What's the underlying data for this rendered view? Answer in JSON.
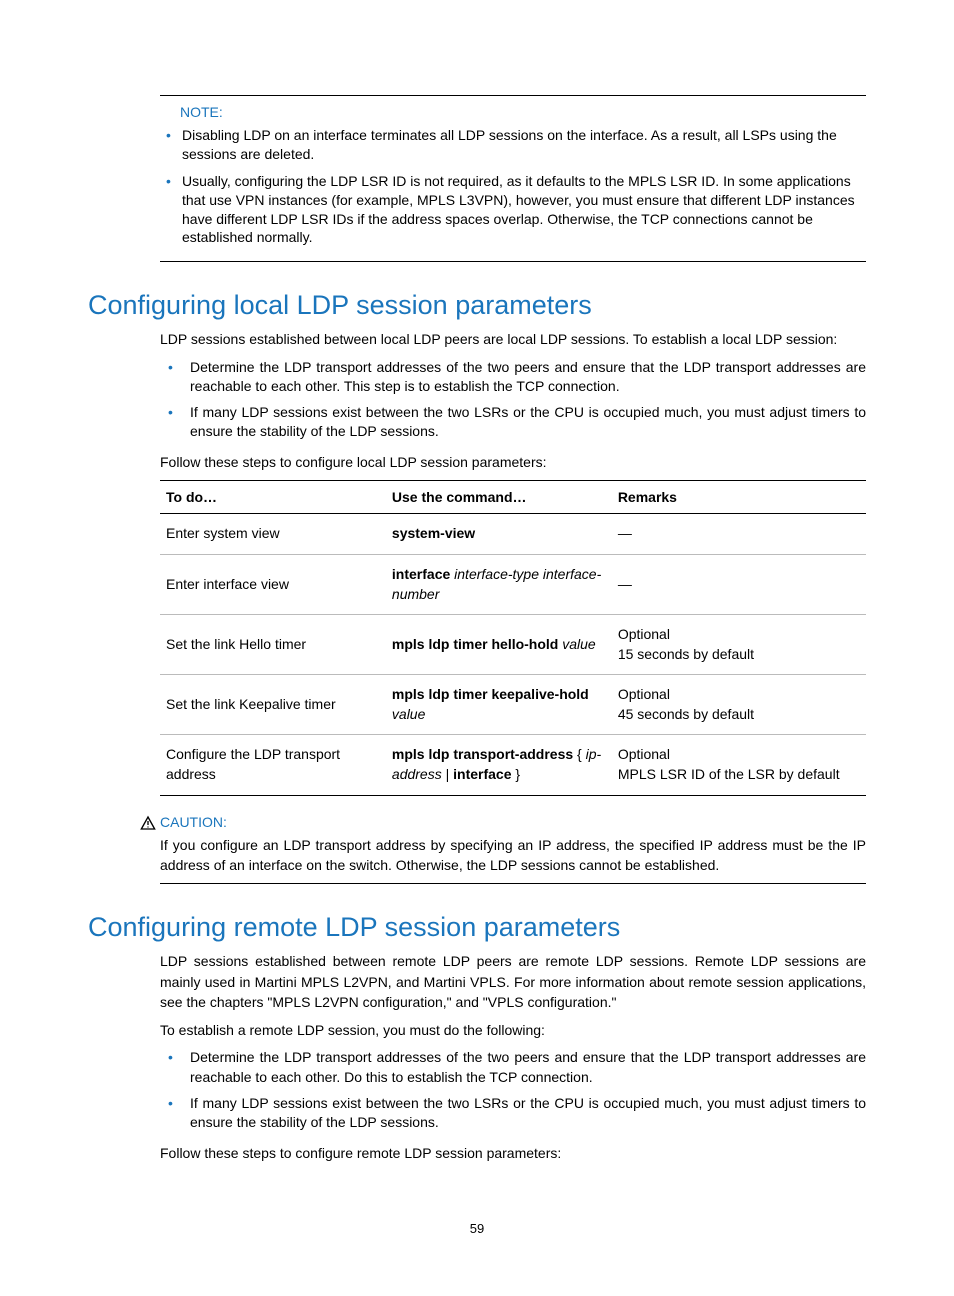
{
  "note": {
    "label": "NOTE:",
    "items": [
      "Disabling LDP on an interface terminates all LDP sessions on the interface. As a result, all LSPs using the sessions are deleted.",
      "Usually, configuring the LDP LSR ID is not required, as it defaults to the MPLS LSR ID. In some applications that use VPN instances (for example, MPLS L3VPN), however, you must ensure that different LDP instances have different LDP LSR IDs if the address spaces overlap. Otherwise, the TCP connections cannot be established normally."
    ]
  },
  "section1": {
    "heading": "Configuring local LDP session parameters",
    "intro": "LDP sessions established between local LDP peers are local LDP sessions. To establish a local LDP session:",
    "bullets": [
      "Determine the LDP transport addresses of the two peers and ensure that the LDP transport addresses are reachable to each other. This step is to establish the TCP connection.",
      "If many LDP sessions exist between the two LSRs or the CPU is occupied much, you must adjust timers to ensure the stability of the LDP sessions."
    ],
    "lead": "Follow these steps to configure local LDP session parameters:"
  },
  "table": {
    "headers": [
      "To do…",
      "Use the command…",
      "Remarks"
    ],
    "rows": [
      {
        "todo": "Enter system view",
        "cmd_html": "<b>system-view</b>",
        "remarks_html": "—"
      },
      {
        "todo": "Enter interface view",
        "cmd_html": "<b>interface</b> <i>interface-type interface-number</i>",
        "remarks_html": "—"
      },
      {
        "todo": "Set the link Hello timer",
        "cmd_html": "<b>mpls ldp timer hello-hold</b> <i>value</i>",
        "remarks_html": "Optional<br>15 seconds by default"
      },
      {
        "todo": "Set the link Keepalive timer",
        "cmd_html": "<b>mpls ldp timer keepalive-hold</b> <i>value</i>",
        "remarks_html": "Optional<br>45 seconds by default"
      },
      {
        "todo": "Configure the LDP transport address",
        "cmd_html": "<b>mpls ldp transport-address</b> { <i>ip-address</i> | <b>interface</b> }",
        "remarks_html": "Optional<br>MPLS LSR ID of the LSR by default"
      }
    ]
  },
  "caution": {
    "label": "CAUTION:",
    "text": "If you configure an LDP transport address by specifying an IP address, the specified IP address must be the IP address of an interface on the switch. Otherwise, the LDP sessions cannot be established."
  },
  "section2": {
    "heading": "Configuring remote LDP session parameters",
    "intro": "LDP sessions established between remote LDP peers are remote LDP sessions. Remote LDP sessions are mainly used in Martini MPLS L2VPN, and Martini VPLS. For more information about remote session applications, see the chapters \"MPLS L2VPN configuration,\" and \"VPLS configuration.\"",
    "lead": "To establish a remote LDP session, you must do the following:",
    "bullets": [
      "Determine the LDP transport addresses of the two peers and ensure that the LDP transport addresses are reachable to each other. Do this to establish the TCP connection.",
      "If many LDP sessions exist between the two LSRs or the CPU is occupied much, you must adjust timers to ensure the stability of the LDP sessions."
    ],
    "trail": "Follow these steps to configure remote LDP session parameters:"
  },
  "page_number": "59"
}
